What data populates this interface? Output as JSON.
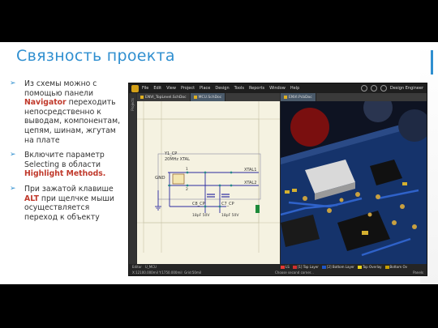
{
  "slide": {
    "title": "Связность проекта",
    "bullets": [
      {
        "before": "Из схемы можно с помощью панели ",
        "highlight": "Navigator",
        "after": " переходить непосредственно к выводам, компонентам, цепям, шинам, жгутам на плате"
      },
      {
        "before": "Включите параметр Selecting в области ",
        "highlight": "Highlight Methods.",
        "after": ""
      },
      {
        "before": "При зажатой клавише ",
        "highlight": "ALT",
        "after": " при щелчке мыши осуществляется переход к объекту"
      }
    ]
  },
  "app": {
    "menu": [
      "File",
      "Edit",
      "View",
      "Project",
      "Place",
      "Design",
      "Tools",
      "Reports",
      "Window",
      "Help"
    ],
    "user": "Design Engineer",
    "left_panel": "Projects",
    "schematic_tabs": [
      "ENVI_TopLevel.SchDoc",
      "MCU.SchDoc"
    ],
    "pcb_tab": "ENVI.PcbDoc",
    "schematic": {
      "labels": {
        "y1": "Y1_CP",
        "freq": "20MHz XTAL",
        "gnd": "GND",
        "xtal1": "XTAL1",
        "xtal2": "XTAL2",
        "c8": "C8_CP",
        "c8v": "18pF 50V",
        "c7": "C7_CP",
        "c7v": "18pF 50V",
        "pin1": "1",
        "pin2": "2"
      }
    },
    "status": {
      "sheet_tabs": [
        "Editor",
        "U_MCU"
      ],
      "coords": "X:12100.000mil Y:1750.000mil",
      "grid": "Grid:50mil",
      "hint": "Choose second corner...",
      "panels": "Panels",
      "layers": [
        {
          "name": "LS",
          "color": "#e53935"
        },
        {
          "name": "[1] Top Layer",
          "color": "#d32f2f"
        },
        {
          "name": "[2] Bottom Layer",
          "color": "#1e56c8"
        },
        {
          "name": "Top Overlay",
          "color": "#e8d21c"
        },
        {
          "name": "Bottom Ov",
          "color": "#c8a000"
        }
      ]
    }
  }
}
